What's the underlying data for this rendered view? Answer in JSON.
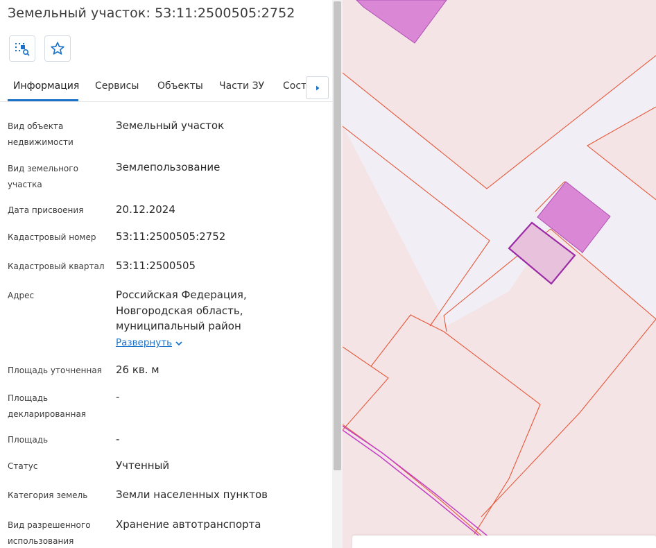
{
  "header": {
    "title": "Земельный участок: 53:11:2500505:2752"
  },
  "toolbar": {
    "buttons": [
      {
        "icon": "locate-on-map-icon"
      },
      {
        "icon": "star-outline-icon"
      }
    ]
  },
  "tabs": [
    {
      "label": "Информация",
      "active": true
    },
    {
      "label": "Сервисы",
      "active": false
    },
    {
      "label": "Объекты",
      "active": false
    },
    {
      "label": "Части ЗУ",
      "active": false
    },
    {
      "label": "Соста",
      "active": false
    }
  ],
  "details": {
    "rows": [
      {
        "label": "Вид объекта недвижимости",
        "value": "Земельный участок"
      },
      {
        "label": "Вид земельного участка",
        "value": "Землепользование"
      },
      {
        "label": "Дата присвоения",
        "value": "20.12.2024"
      },
      {
        "label": "Кадастровый номер",
        "value": "53:11:2500505:2752"
      },
      {
        "label": "Кадастровый квартал",
        "value": "53:11:2500505"
      },
      {
        "label": "Адрес",
        "value": "Российская Федерация,\nНовгородская область,\nмуниципальный район"
      },
      {
        "label": "Площадь уточненная",
        "value": "26 кв. м"
      },
      {
        "label": "Площадь декларированная",
        "value": "-"
      },
      {
        "label": "Площадь",
        "value": "-"
      },
      {
        "label": "Статус",
        "value": "Учтенный"
      },
      {
        "label": "Категория земель",
        "value": "Земли населенных пунктов"
      },
      {
        "label": "Вид разрешенного использования",
        "value": "Хранение автотранспорта"
      }
    ],
    "expand_label": "Развернуть"
  },
  "colors": {
    "accent": "#1a73c8",
    "map_background": "#f4e4e5",
    "parcel_border": "#e5583a",
    "selected_parcel_fill": "#e8c2dc",
    "selected_parcel_border": "#9a2aa6",
    "building_fill": "#da88d6",
    "road_fill": "#f1eff5"
  }
}
